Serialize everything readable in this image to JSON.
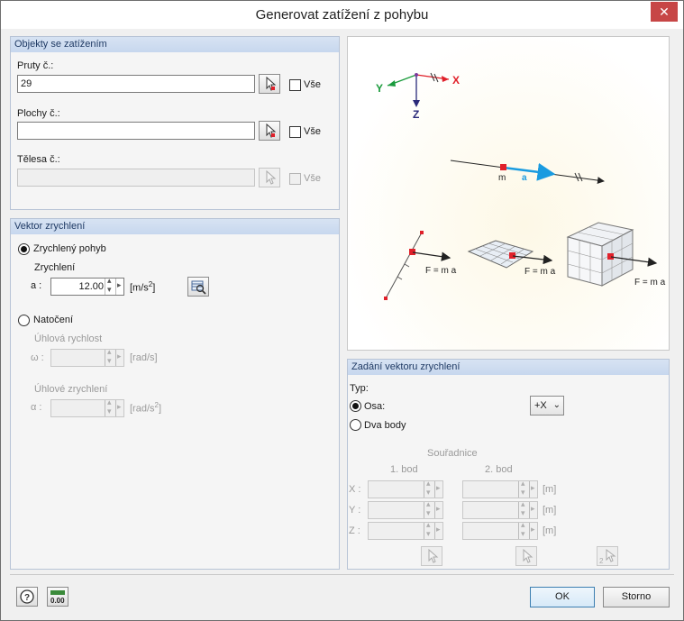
{
  "window": {
    "title": "Generovat zatížení z pohybu",
    "close_glyph": "✕"
  },
  "objects": {
    "header": "Objekty se zatížením",
    "members": {
      "label": "Pruty č.:",
      "value": "29",
      "all_label": "Vše"
    },
    "surfaces": {
      "label": "Plochy č.:",
      "value": "",
      "all_label": "Vše"
    },
    "solids": {
      "label": "Tělesa č.:",
      "value": "",
      "all_label": "Vše"
    }
  },
  "vector": {
    "header": "Vektor zrychlení",
    "accelerated": {
      "label": "Zrychlený pohyb",
      "sub_label": "Zrychlení",
      "a_label": "a :",
      "a_value": "12.00",
      "unit": "[m/s",
      "unit_sup": "2",
      "unit_close": "]"
    },
    "rotation": {
      "label": "Natočení",
      "omega_title": "Úhlová rychlost",
      "omega_label": "ω :",
      "omega_unit": "[rad/s]",
      "alpha_title": "Úhlové zrychlení",
      "alpha_label": "α :",
      "alpha_unit": "[rad/s",
      "alpha_unit_sup": "2",
      "alpha_unit_close": "]"
    }
  },
  "diagram": {
    "axis_x": "X",
    "axis_y": "Y",
    "axis_z": "Z",
    "mass": "m",
    "accel": "a",
    "force_label": "F = m a"
  },
  "spec": {
    "header": "Zadání vektoru zrychlení",
    "type_label": "Typ:",
    "axis_label": "Osa:",
    "axis_value": "+X",
    "two_points_label": "Dva body",
    "coords_title": "Souřadnice",
    "point1": "1. bod",
    "point2": "2. bod",
    "x": "X :",
    "y": "Y :",
    "z": "Z :",
    "unit": "[m]"
  },
  "buttons": {
    "ok": "OK",
    "cancel": "Storno"
  },
  "colors": {
    "accent": "#1a9be0",
    "marker": "#e0202a",
    "axis_x": "#e0202a",
    "axis_y": "#1a9b3c",
    "axis_z": "#2a2a7a"
  }
}
